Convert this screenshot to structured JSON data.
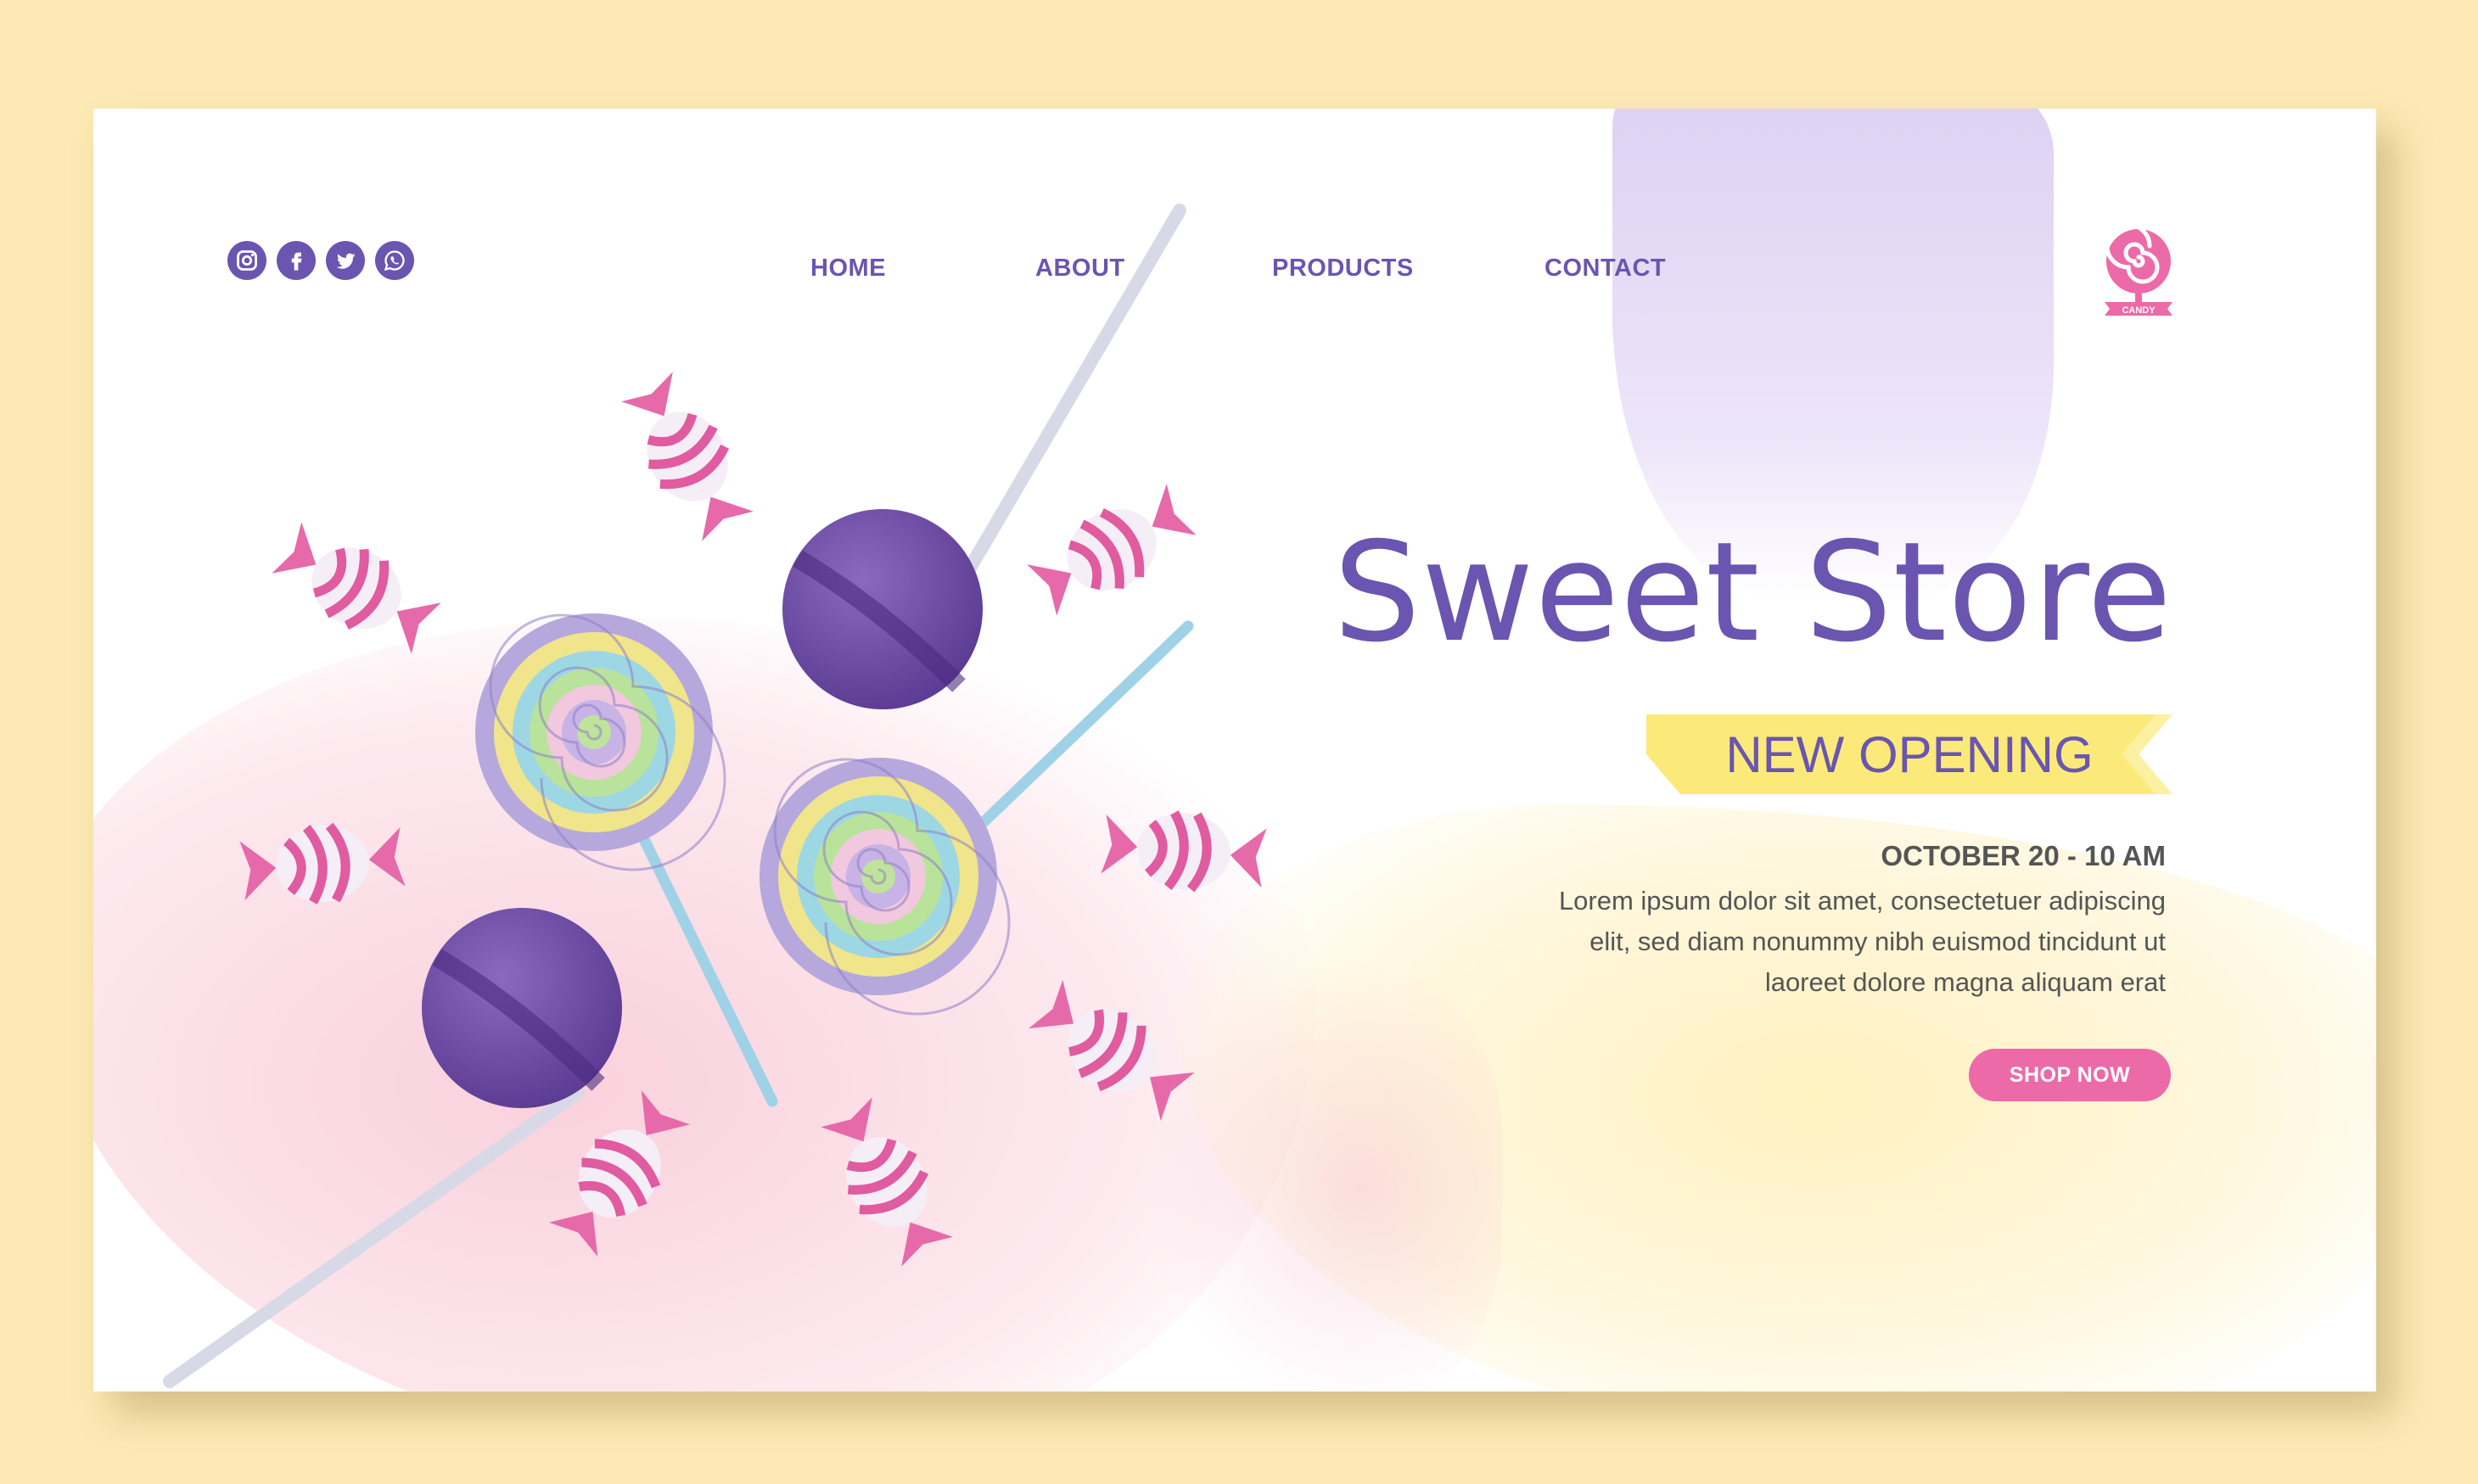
{
  "social": {
    "items": [
      {
        "name": "instagram"
      },
      {
        "name": "facebook"
      },
      {
        "name": "twitter"
      },
      {
        "name": "whatsapp"
      }
    ]
  },
  "nav": {
    "items": [
      "HOME",
      "ABOUT",
      "PRODUCTS",
      "CONTACT"
    ]
  },
  "logo": {
    "label": "CANDY",
    "icon": "lollipop-swirl-icon"
  },
  "hero": {
    "title": "Sweet Store",
    "ribbon": "NEW OPENING",
    "date": "OCTOBER 20 - 10 AM",
    "description": "Lorem ipsum dolor sit amet, consectetuer adipiscing elit, sed diam nonummy nibh euismod tincidunt ut laoreet dolore magna aliquam erat",
    "cta": "SHOP NOW"
  },
  "colors": {
    "page_background": "#fde9b4",
    "accent_purple": "#6a55b0",
    "cta_pink": "#ec6aa8",
    "ribbon_yellow": "#fbe97a"
  }
}
